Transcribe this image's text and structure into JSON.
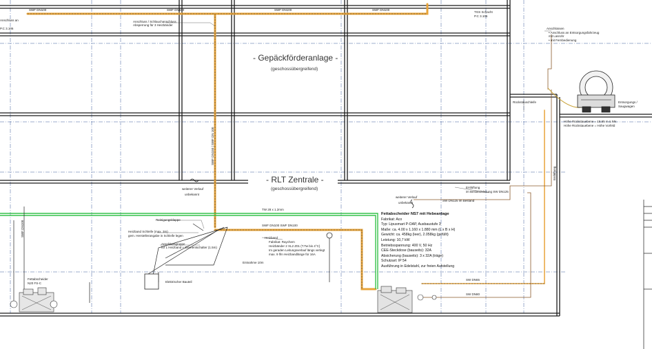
{
  "titles": {
    "gepaeck": "- Gepäckförderanlage -",
    "gepaeck_sub": "(geschossübergreifend)",
    "rlt": "- RLT Zentrale -",
    "rlt_sub": "(geschossübergreifend)"
  },
  "labels": {
    "swf_dn100_top1": "SWF DN100",
    "swf_dn100_top2": "SWF DN100",
    "swf_dn100_top3": "SWF DN100",
    "swf_dn100_top4": "SWF DN100",
    "tgs_schacht": "TGS Schacht",
    "tgs_sub": "P.C 3.106",
    "left_dn": "SWF DN100",
    "left_ref": "P.C 3.106",
    "left_anschluss": "Anschluss an",
    "anschluss_note": "Anschluss / Schlauchanschluss",
    "anschluss_note2": "Absperrung für 3 Heizbänder",
    "riser_label": "SWF DN150 | SWF DN 100",
    "weiterer_verlauf": "weiterer Verlauf",
    "unbekannt": "unbekannt",
    "weiterer_verlauf_r": "weiterer Verlauf",
    "unbekannt_r": "unbekannt",
    "tw_line": "TW 28 x 1.2mm",
    "swf_pipe": "SWF DN100  SWF DN100",
    "reinigungsklappe": "Reinigungsklappe",
    "heizband1": "Heizband Schleife (max. 3m)",
    "heizband2": "gem. Herstellerangabe in Schleife legen",
    "anschluss_grp1": "Anschlussgruppe",
    "anschluss_grp2": "für 1 Heizband + Elementschalter (1.5m)",
    "schalter_box": "Elektrischer Bauteil",
    "entnahme": "Entnahme 10m",
    "heizband_note_title": "Heizband",
    "heizband_note1": "Fabrikat: Raychem",
    "heizband_note2": "Heizbänder 2 XL2 Z01 (T.Tw bis 4°C)",
    "heizband_note3": "Im geraden Leitungsverlauf längs verlegt",
    "heizband_note4": "max. 9 lfm Heizbandlänge für 16A",
    "fettab_left1": "Fettabscheider",
    "fettab_left2": "N20  FS-C",
    "right_sw_dn": "SW DN125 im Bestand",
    "right_note1": "Entlüftung",
    "right_note2": "im Bestandsleitung SW DN125",
    "vertical_right": "Entlüftung",
    "sw_dn65": "SW DN65",
    "sw_dn80": "SW DN80",
    "top_right1": "Anschlüssen",
    "top_right2": "• Anschluss an Entsorgungsfahrzeug",
    "top_right3": "  mit Lasrohr",
    "top_right4": "• mit Fernbedienung",
    "entsorgung1": "Entsorgungs /",
    "entsorgung2": "Saugwagen",
    "height1": "Höhe Rückstauebene = 18.95 m ü.NN",
    "height2": "Höhe Rückstauebene = Höhe Vorfeld",
    "rueckstau_top": "Rückstauschleife"
  },
  "spec": {
    "title": "Fettabscheider  NS7  mit Hebeanlage",
    "lines": [
      "Fabrikat: Aco",
      "Typ: Lipusmart P-OAP, Ausbaustufe 3",
      "Maße: ca. 4.00 x 1.160 x 1.880 mm (L x B x H)",
      "Gewicht: ca. 458kg (leer), 2.058kg (gefüllt)",
      "Leistung: 10,7 kW",
      "Betriebsspannung: 400 V, 50 Hz",
      "CEE-Steckdose (bauseits): 32A",
      "Absicherung (bauseits): 3 x 32A (träge)",
      "Schutzart: IP 54",
      "Ausführung in Edelstahl, zur freien Aufstellung"
    ]
  },
  "colors": {
    "orange": "#e8a43a",
    "green": "#35c24a",
    "olive": "#c9a33b",
    "dark": "#1a1a1a",
    "blue_dash": "#3a5a9a"
  }
}
